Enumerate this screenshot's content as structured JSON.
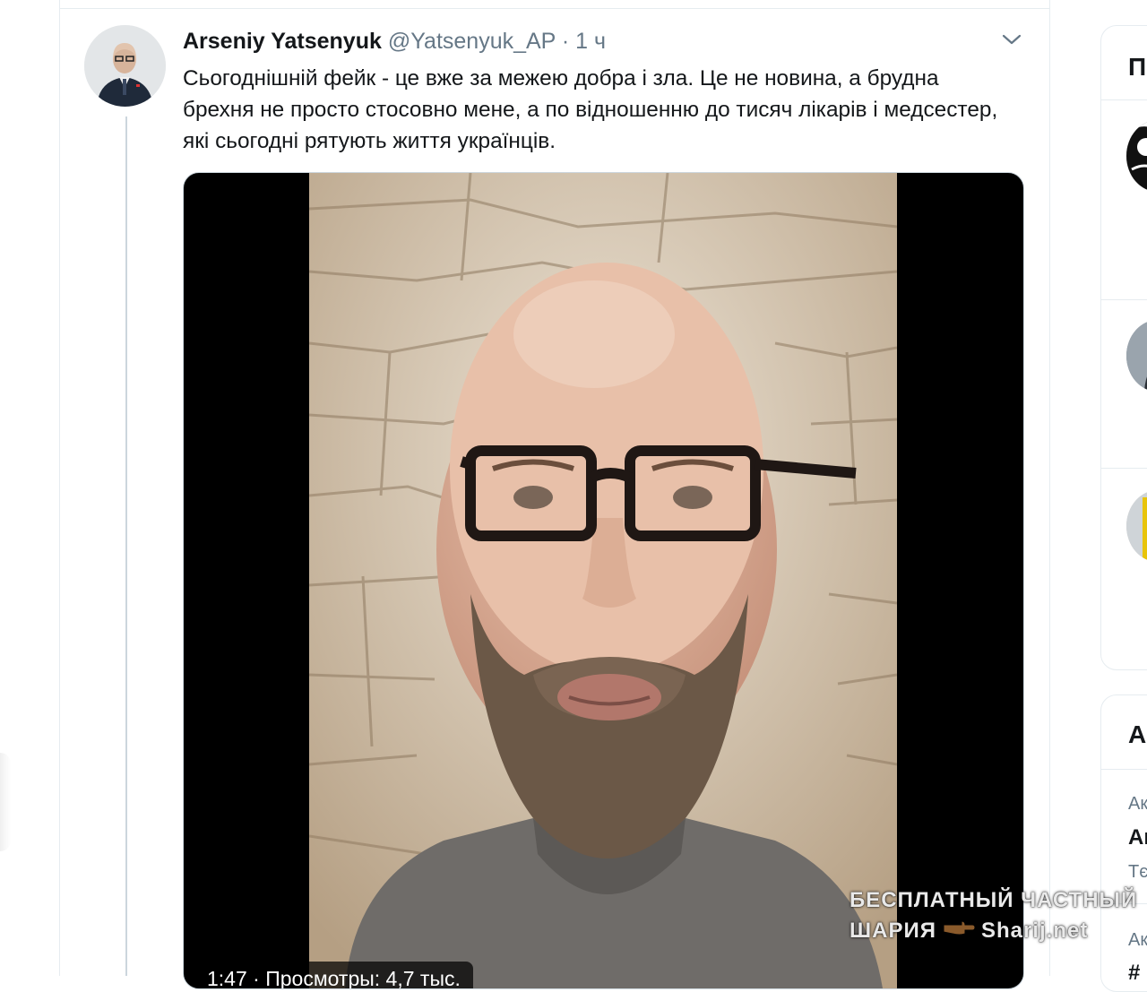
{
  "tweet": {
    "author_name": "Arseniy Yatsenyuk",
    "author_handle": "@Yatsenyuk_AP",
    "separator": "·",
    "time": "1 ч",
    "text": "Сьогоднішній фейк - це вже за межею добра і зла. Це не новина, а брудна брехня не просто стосовно мене, а по відношенню до тисяч лікарів і медсестер, які сьогодні рятують життя українців.",
    "menu_icon": "chevron-down-icon",
    "video": {
      "info": "1:47 · Просмотры: 4,7 тыс."
    }
  },
  "sidebar": {
    "card1_title": "П",
    "card2_title": "А",
    "card2_items": [
      "Ак",
      "Аı",
      "Тє",
      "Ак",
      "#"
    ]
  },
  "watermark": {
    "line1": "БЕСПЛАТНЫЙ  ЧАСТНЫЙ",
    "line2a": "ШАРИЯ",
    "line2b": "Sharij.net"
  },
  "colors": {
    "text": "#14171a",
    "secondary": "#657786",
    "border": "#e6ecf0",
    "media_bg": "#000000"
  }
}
